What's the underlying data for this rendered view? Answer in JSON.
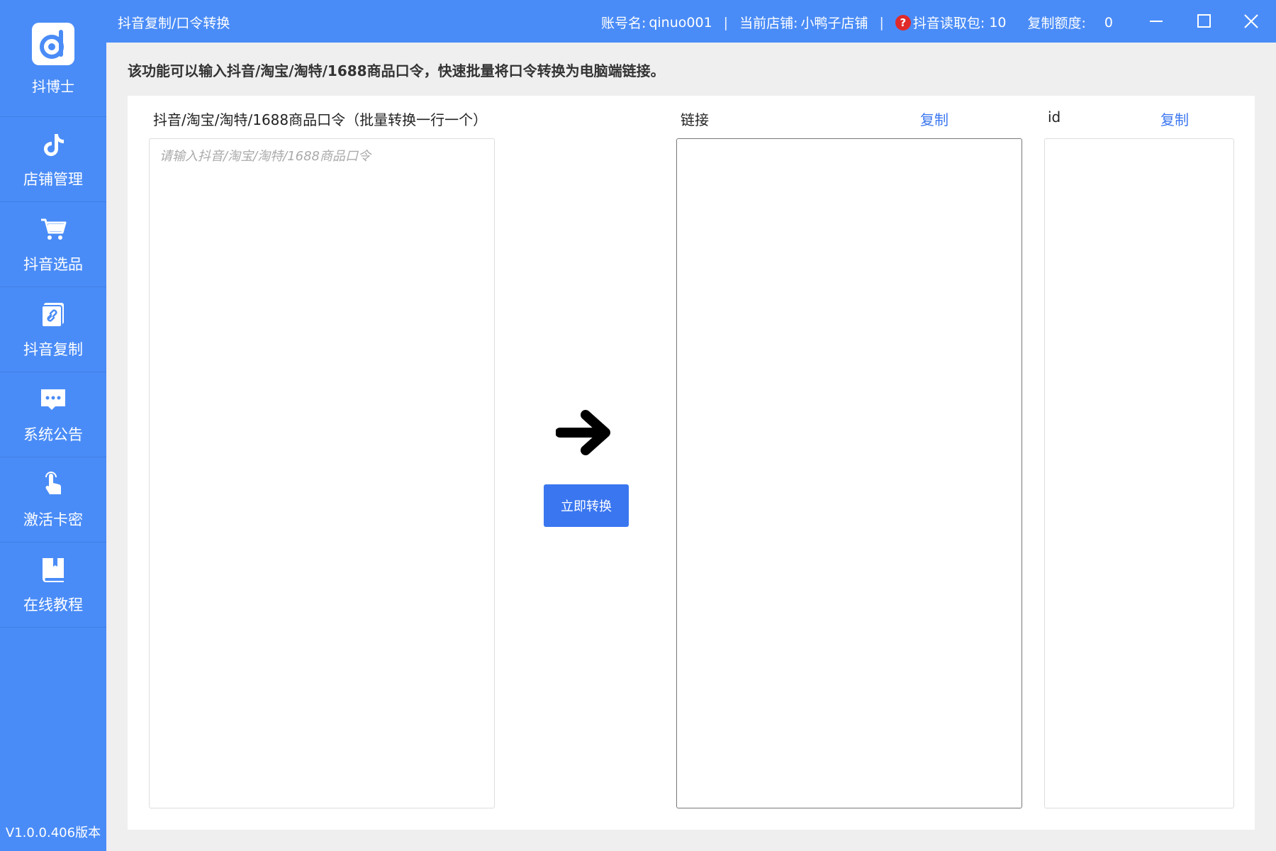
{
  "app": {
    "logo_text": "抖博士",
    "version": "V1.0.0.406版本"
  },
  "sidebar": {
    "items": [
      {
        "label": "店铺管理",
        "icon": "tiktok-icon"
      },
      {
        "label": "抖音选品",
        "icon": "cart-icon"
      },
      {
        "label": "抖音复制",
        "icon": "link-copy-icon"
      },
      {
        "label": "系统公告",
        "icon": "message-icon"
      },
      {
        "label": "激活卡密",
        "icon": "touch-icon"
      },
      {
        "label": "在线教程",
        "icon": "book-icon"
      }
    ]
  },
  "titlebar": {
    "title": "抖音复制/口令转换",
    "account_label": "账号名:",
    "account_value": "qinuo001",
    "store_label": "当前店铺:",
    "store_value": "小鸭子店铺",
    "read_label": "抖音读取包:",
    "read_value": "10",
    "quota_label": "复制额度:",
    "quota_value": "0"
  },
  "main": {
    "description": "该功能可以输入抖音/淘宝/淘特/1688商品口令，快速批量将口令转换为电脑端链接。",
    "input_label": "抖音/淘宝/淘特/1688商品口令（批量转换一行一个）",
    "input_placeholder": "请输入抖音/淘宝/淘特/1688商品口令",
    "convert_button": "立即转换",
    "link_label": "链接",
    "link_copy": "复制",
    "id_label": "id",
    "id_copy": "复制"
  },
  "colors": {
    "sidebar_bg": "#4a8cf7",
    "accent": "#3a76f0",
    "help_badge": "#e02a2a"
  }
}
